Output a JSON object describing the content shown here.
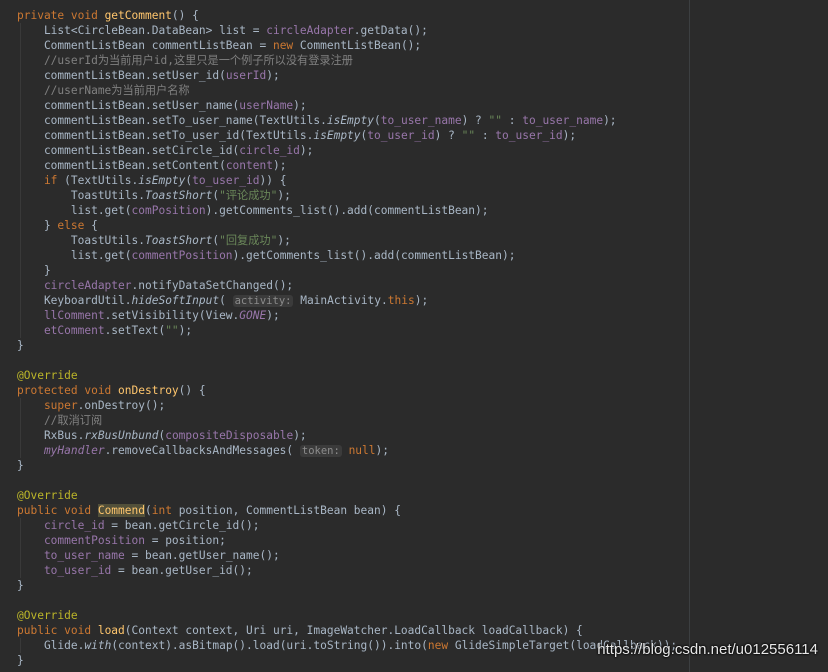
{
  "editor": {
    "lines": [
      [
        [
          "kw",
          "private void "
        ],
        [
          "fn",
          "getComment"
        ],
        [
          "pl",
          "() {"
        ]
      ],
      [
        [
          "pl",
          "    List<CircleBean.DataBean> list = "
        ],
        [
          "fld",
          "circleAdapter"
        ],
        [
          "pl",
          ".getData();"
        ]
      ],
      [
        [
          "pl",
          "    CommentListBean commentListBean = "
        ],
        [
          "kw",
          "new "
        ],
        [
          "pl",
          "CommentListBean();"
        ]
      ],
      [
        [
          "com",
          "    //userId为当前用户id,这里只是一个例子所以没有登录注册"
        ]
      ],
      [
        [
          "pl",
          "    commentListBean.setUser_id("
        ],
        [
          "fld",
          "userId"
        ],
        [
          "pl",
          ");"
        ]
      ],
      [
        [
          "com",
          "    //userName为当前用户名称"
        ]
      ],
      [
        [
          "pl",
          "    commentListBean.setUser_name("
        ],
        [
          "fld",
          "userName"
        ],
        [
          "pl",
          ");"
        ]
      ],
      [
        [
          "pl",
          "    commentListBean.setTo_user_name(TextUtils."
        ],
        [
          "static",
          "isEmpty"
        ],
        [
          "pl",
          "("
        ],
        [
          "fld",
          "to_user_name"
        ],
        [
          "pl",
          ") ? "
        ],
        [
          "str",
          "\"\""
        ],
        [
          "pl",
          " : "
        ],
        [
          "fld",
          "to_user_name"
        ],
        [
          "pl",
          ");"
        ]
      ],
      [
        [
          "pl",
          "    commentListBean.setTo_user_id(TextUtils."
        ],
        [
          "static",
          "isEmpty"
        ],
        [
          "pl",
          "("
        ],
        [
          "fld",
          "to_user_id"
        ],
        [
          "pl",
          ") ? "
        ],
        [
          "str",
          "\"\""
        ],
        [
          "pl",
          " : "
        ],
        [
          "fld",
          "to_user_id"
        ],
        [
          "pl",
          ");"
        ]
      ],
      [
        [
          "pl",
          "    commentListBean.setCircle_id("
        ],
        [
          "fld",
          "circle_id"
        ],
        [
          "pl",
          ");"
        ]
      ],
      [
        [
          "pl",
          "    commentListBean.setContent("
        ],
        [
          "fld",
          "content"
        ],
        [
          "pl",
          ");"
        ]
      ],
      [
        [
          "kw",
          "    if "
        ],
        [
          "pl",
          "(TextUtils."
        ],
        [
          "static",
          "isEmpty"
        ],
        [
          "pl",
          "("
        ],
        [
          "fld",
          "to_user_id"
        ],
        [
          "pl",
          ")) {"
        ]
      ],
      [
        [
          "pl",
          "        ToastUtils."
        ],
        [
          "static",
          "ToastShort"
        ],
        [
          "pl",
          "("
        ],
        [
          "str",
          "\"评论成功\""
        ],
        [
          "pl",
          ");"
        ]
      ],
      [
        [
          "pl",
          "        list.get("
        ],
        [
          "fld",
          "comPosition"
        ],
        [
          "pl",
          ").getComments_list().add(commentListBean);"
        ]
      ],
      [
        [
          "pl",
          "    } "
        ],
        [
          "kw",
          "else "
        ],
        [
          "pl",
          "{"
        ]
      ],
      [
        [
          "pl",
          "        ToastUtils."
        ],
        [
          "static",
          "ToastShort"
        ],
        [
          "pl",
          "("
        ],
        [
          "str",
          "\"回复成功\""
        ],
        [
          "pl",
          ");"
        ]
      ],
      [
        [
          "pl",
          "        list.get("
        ],
        [
          "fld",
          "commentPosition"
        ],
        [
          "pl",
          ").getComments_list().add(commentListBean);"
        ]
      ],
      [
        [
          "pl",
          "    }"
        ]
      ],
      [
        [
          "fld",
          "    circleAdapter"
        ],
        [
          "pl",
          ".notifyDataSetChanged();"
        ]
      ],
      [
        [
          "pl",
          "    KeyboardUtil."
        ],
        [
          "static",
          "hideSoftInput"
        ],
        [
          "pl",
          "( "
        ],
        [
          "hint",
          "activity:"
        ],
        [
          "pl",
          " MainActivity."
        ],
        [
          "kw",
          "this"
        ],
        [
          "pl",
          ");"
        ]
      ],
      [
        [
          "fld",
          "    llComment"
        ],
        [
          "pl",
          ".setVisibility(View."
        ],
        [
          "fldit",
          "GONE"
        ],
        [
          "pl",
          ");"
        ]
      ],
      [
        [
          "fld",
          "    etComment"
        ],
        [
          "pl",
          ".setText("
        ],
        [
          "str",
          "\"\""
        ],
        [
          "pl",
          ");"
        ]
      ],
      [
        [
          "pl",
          "}"
        ]
      ],
      [
        [
          "pl",
          ""
        ]
      ],
      [
        [
          "ann",
          "@Override"
        ]
      ],
      [
        [
          "kw",
          "protected void "
        ],
        [
          "fn",
          "onDestroy"
        ],
        [
          "pl",
          "() {"
        ]
      ],
      [
        [
          "kw",
          "    super"
        ],
        [
          "pl",
          ".onDestroy();"
        ]
      ],
      [
        [
          "com",
          "    //取消订阅"
        ]
      ],
      [
        [
          "pl",
          "    RxBus."
        ],
        [
          "static",
          "rxBusUnbund"
        ],
        [
          "pl",
          "("
        ],
        [
          "fld",
          "compositeDisposable"
        ],
        [
          "pl",
          ");"
        ]
      ],
      [
        [
          "fldit",
          "    myHandler"
        ],
        [
          "pl",
          ".removeCallbacksAndMessages( "
        ],
        [
          "hint",
          "token:"
        ],
        [
          "kw",
          " null"
        ],
        [
          "pl",
          ");"
        ]
      ],
      [
        [
          "pl",
          "}"
        ]
      ],
      [
        [
          "pl",
          ""
        ]
      ],
      [
        [
          "ann",
          "@Override"
        ]
      ],
      [
        [
          "kw",
          "public void "
        ],
        [
          "fnhl",
          "Commend"
        ],
        [
          "pl",
          "("
        ],
        [
          "kw",
          "int "
        ],
        [
          "pl",
          "position, CommentListBean bean) {"
        ]
      ],
      [
        [
          "fld",
          "    circle_id"
        ],
        [
          "pl",
          " = bean.getCircle_id();"
        ]
      ],
      [
        [
          "fld",
          "    commentPosition"
        ],
        [
          "pl",
          " = position;"
        ]
      ],
      [
        [
          "fld",
          "    to_user_name"
        ],
        [
          "pl",
          " = bean.getUser_name();"
        ]
      ],
      [
        [
          "fld",
          "    to_user_id"
        ],
        [
          "pl",
          " = bean.getUser_id();"
        ]
      ],
      [
        [
          "pl",
          "}"
        ]
      ],
      [
        [
          "pl",
          ""
        ]
      ],
      [
        [
          "ann",
          "@Override"
        ]
      ],
      [
        [
          "kw",
          "public void "
        ],
        [
          "fn",
          "load"
        ],
        [
          "pl",
          "(Context context, Uri uri, ImageWatcher.LoadCallback loadCallback) {"
        ]
      ],
      [
        [
          "pl",
          "    Glide."
        ],
        [
          "static",
          "with"
        ],
        [
          "pl",
          "(context).asBitmap().load(uri.toString()).into("
        ],
        [
          "kw",
          "new "
        ],
        [
          "pl",
          "GlideSimpleTarget(loadCallback));"
        ]
      ],
      [
        [
          "pl",
          "}"
        ]
      ]
    ]
  },
  "watermark": "https://blog.csdn.net/u012556114"
}
